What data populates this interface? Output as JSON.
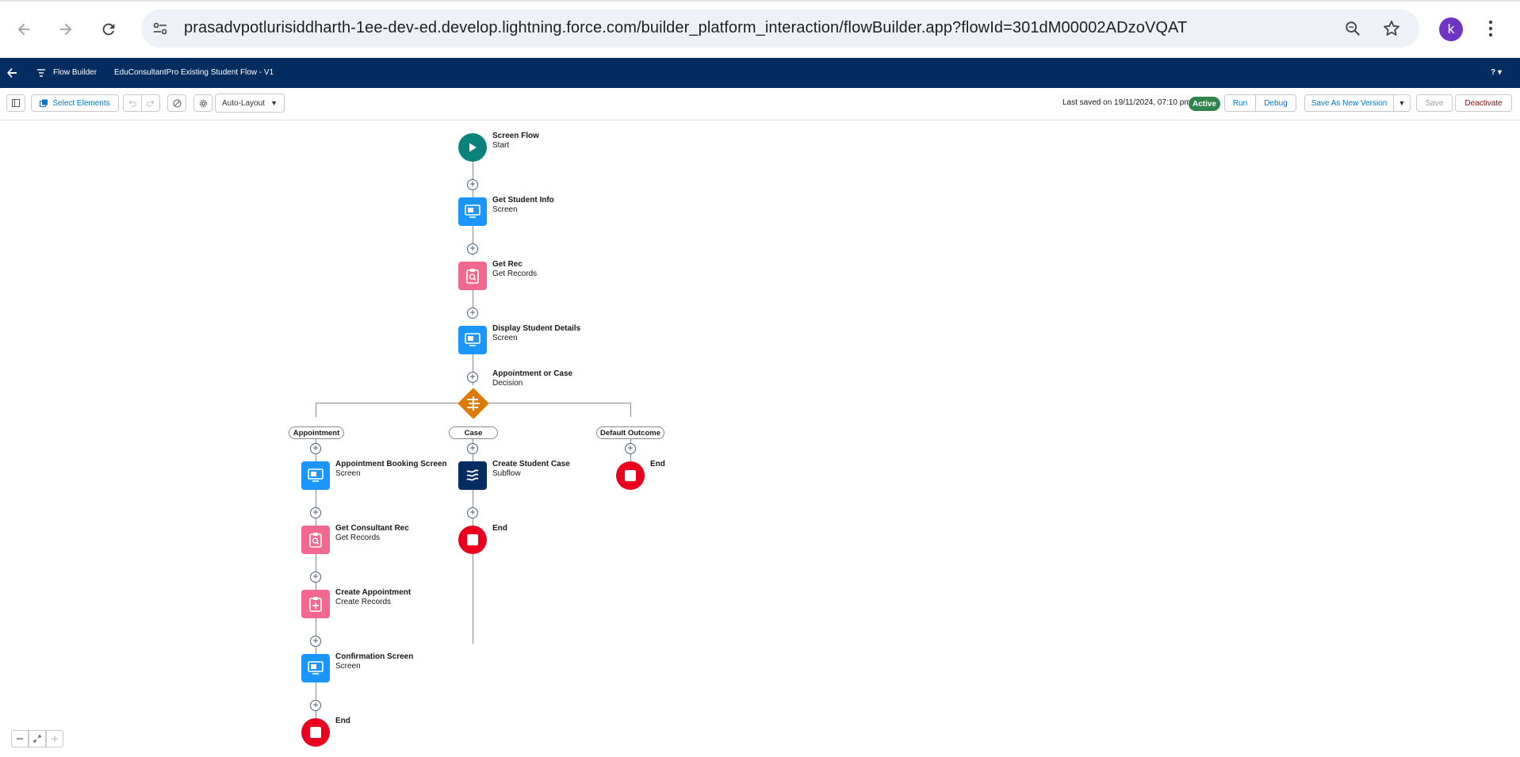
{
  "browser": {
    "url": "prasadvpotlurisiddharth-1ee-dev-ed.develop.lightning.force.com/builder_platform_interaction/flowBuilder.app?flowId=301dM00002ADzoVQAT",
    "avatar_letter": "k"
  },
  "header": {
    "app_name": "Flow Builder",
    "flow_title": "EduConsultantPro Existing Student Flow - V1",
    "help": "?"
  },
  "toolbar": {
    "select_elements": "Select Elements",
    "layout_mode": "Auto-Layout",
    "last_saved": "Last saved on 19/11/2024, 07:10 pm",
    "status": "Active",
    "run": "Run",
    "debug": "Debug",
    "save_as_new_version": "Save As New Version",
    "save": "Save",
    "deactivate": "Deactivate"
  },
  "flow": {
    "start": {
      "name": "Screen Flow",
      "type": "Start"
    },
    "main": [
      {
        "name": "Get Student Info",
        "type": "Screen"
      },
      {
        "name": "Get Rec",
        "type": "Get Records"
      },
      {
        "name": "Display Student Details",
        "type": "Screen"
      }
    ],
    "decision": {
      "name": "Appointment or Case",
      "type": "Decision"
    },
    "branches": [
      {
        "label": "Appointment",
        "elements": [
          {
            "name": "Appointment Booking Screen",
            "type": "Screen"
          },
          {
            "name": "Get Consultant Rec",
            "type": "Get Records"
          },
          {
            "name": "Create Appointment",
            "type": "Create Records"
          },
          {
            "name": "Confirmation Screen",
            "type": "Screen"
          }
        ],
        "end": "End"
      },
      {
        "label": "Case",
        "elements": [
          {
            "name": "Create Student Case",
            "type": "Subflow"
          }
        ],
        "end": "End"
      },
      {
        "label": "Default Outcome",
        "elements": [],
        "end": "End"
      }
    ]
  },
  "colors": {
    "header_bg": "#032d60",
    "screen": "#1b96ff",
    "records": "#f26891",
    "decision": "#dd7a01",
    "start": "#0b827c",
    "end": "#ea001e",
    "subflow": "#032d60",
    "active_badge": "#2e844a"
  }
}
